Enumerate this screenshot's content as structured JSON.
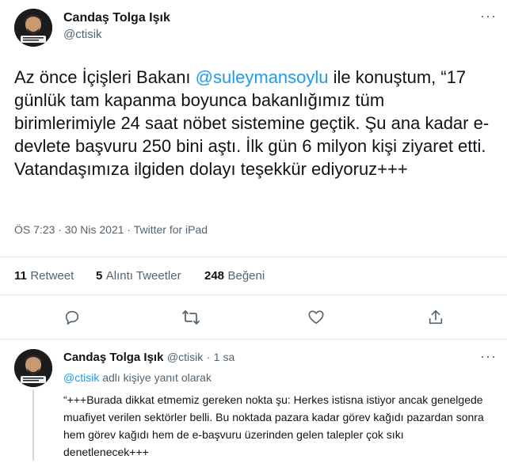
{
  "tweet": {
    "author_name": "Candaş Tolga Işık",
    "author_handle": "@ctisik",
    "more_label": "···",
    "text_before": "Az önce İçişleri Bakanı ",
    "mention": "@suleymansoylu",
    "text_after": " ile konuştum, “17 günlük tam kapanma boyunca bakanlığımız tüm birimlerimiyle 24 saat nöbet sistemine geçtik. Şu ana kadar e-devlete başvuru 250 bini aştı. İlk gün 6 milyon kişi ziyaret etti. Vatandaşımıza ilgiden dolayı teşekkür ediyoruz+++",
    "timestamp": "ÖS 7:23 · 30 Nis 2021 · Twitter for iPad",
    "stats": {
      "retweets_count": "11",
      "retweets_label": "Retweet",
      "quotes_count": "5",
      "quotes_label": "Alıntı Tweetler",
      "likes_count": "248",
      "likes_label": "Beğeni"
    },
    "actions": {
      "reply": "reply-icon",
      "retweet": "retweet-icon",
      "like": "heart-icon",
      "share": "share-icon"
    }
  },
  "reply": {
    "author_name": "Candaş Tolga Işık",
    "author_handle": "@ctisik",
    "time": "1 sa",
    "reply_to_mention": "@ctisik",
    "reply_to_suffix": " adlı kişiye yanıt olarak",
    "text": "“+++Burada dikkat etmemiz gereken nokta şu: Herkes istisna istiyor ancak genelgede muafiyet verilen sektörler belli. Bu noktada pazara kadar görev kağıdı pazardan sonra hem görev kağıdı hem de e-başvuru üzerinden gelen talepler çok sıkı denetlenecek+++"
  },
  "colors": {
    "accent": "#1d9bf0",
    "secondary_text": "#536471",
    "divider": "#e6ecf0"
  }
}
